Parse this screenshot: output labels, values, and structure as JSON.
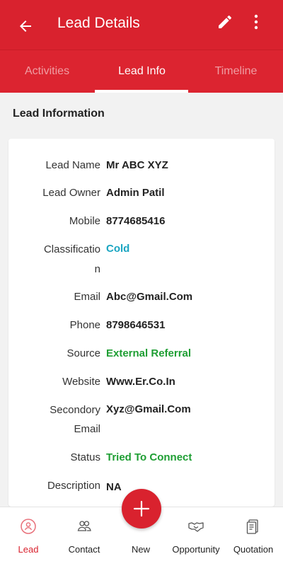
{
  "header": {
    "title": "Lead Details"
  },
  "tabs": [
    {
      "label": "Activities"
    },
    {
      "label": "Lead Info"
    },
    {
      "label": "Timeline"
    }
  ],
  "section": {
    "title": "Lead Information"
  },
  "fields": [
    {
      "label": "Lead Name",
      "value": "Mr ABC XYZ"
    },
    {
      "label": "Lead Owner",
      "value": "Admin Patil"
    },
    {
      "label": "Mobile",
      "value": "8774685416"
    },
    {
      "label_line1": "Classificatio",
      "label_line2": "n",
      "value": "Cold"
    },
    {
      "label": "Email",
      "value": "Abc@Gmail.Com"
    },
    {
      "label": "Phone",
      "value": "8798646531"
    },
    {
      "label": "Source",
      "value": "External Referral"
    },
    {
      "label": "Website",
      "value": "Www.Er.Co.In"
    },
    {
      "label_line1": "Secondory",
      "label_line2": "Email",
      "value": "Xyz@Gmail.Com"
    },
    {
      "label": "Status",
      "value": "Tried To Connect"
    },
    {
      "label": "Description",
      "value": "NA"
    }
  ],
  "nav": [
    {
      "label": "Lead",
      "icon": "lead-icon"
    },
    {
      "label": "Contact",
      "icon": "contact-icon"
    },
    {
      "label": "New",
      "icon": "plus-icon"
    },
    {
      "label": "Opportunity",
      "icon": "handshake-icon"
    },
    {
      "label": "Quotation",
      "icon": "document-icon"
    }
  ],
  "colors": {
    "brand": "#d9222e",
    "cold": "#1aa5c1",
    "positive": "#1e9e33"
  }
}
